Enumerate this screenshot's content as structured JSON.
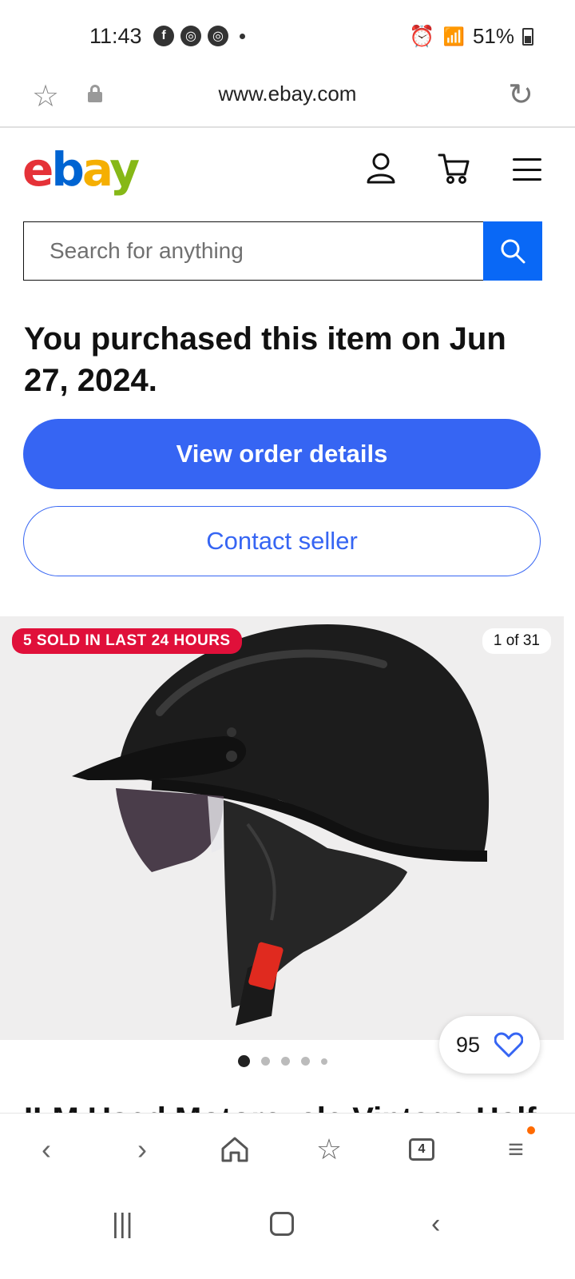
{
  "status_bar": {
    "time": "11:43",
    "notification_icons": [
      "facebook-icon",
      "chrome-icon",
      "chrome-icon"
    ],
    "battery": "51%"
  },
  "browser": {
    "url": "www.ebay.com",
    "open_tabs": "4"
  },
  "header": {
    "logo": [
      "e",
      "b",
      "a",
      "y"
    ]
  },
  "search": {
    "placeholder": "Search for anything"
  },
  "purchase_notice": "You purchased this item on Jun 27, 2024.",
  "actions": {
    "view_order": "View order details",
    "contact_seller": "Contact seller"
  },
  "gallery": {
    "sold_badge": "5 SOLD IN LAST 24 HOURS",
    "image_counter": "1 of 31",
    "watch_count": "95"
  },
  "item_title_peek": "ILM Used Motorcycle Vintage Half",
  "colors": {
    "primary_blue": "#3665f3",
    "search_blue": "#0968f6",
    "sold_red": "#e0103a"
  }
}
